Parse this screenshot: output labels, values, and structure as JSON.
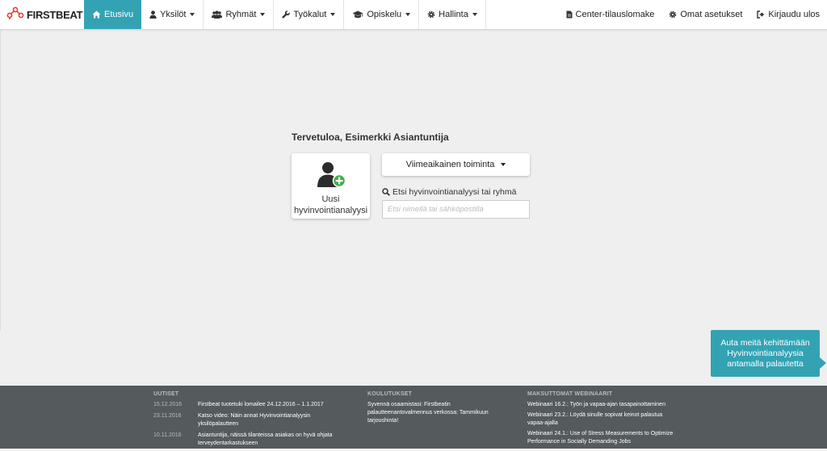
{
  "brand": {
    "name": "FIRSTBEAT"
  },
  "nav": {
    "items": [
      {
        "label": "Etusivu",
        "icon": "home-icon",
        "active": true,
        "dropdown": false
      },
      {
        "label": "Yksilöt",
        "icon": "user-icon",
        "active": false,
        "dropdown": true
      },
      {
        "label": "Ryhmät",
        "icon": "users-icon",
        "active": false,
        "dropdown": true
      },
      {
        "label": "Työkalut",
        "icon": "wrench-icon",
        "active": false,
        "dropdown": true
      },
      {
        "label": "Opiskelu",
        "icon": "graduation-cap-icon",
        "active": false,
        "dropdown": true
      },
      {
        "label": "Hallinta",
        "icon": "gear-icon",
        "active": false,
        "dropdown": true
      }
    ],
    "right": [
      {
        "label": "Center-tilauslomake",
        "icon": "document-icon"
      },
      {
        "label": "Omat asetukset",
        "icon": "gear-icon"
      },
      {
        "label": "Kirjaudu ulos",
        "icon": "sign-out-icon"
      }
    ]
  },
  "main": {
    "welcome": "Tervetuloa, Esimerkki Asiantuntija",
    "new_analysis": {
      "line1": "Uusi",
      "line2": "hyvinvointianalyysi",
      "icon": "add-user-icon"
    },
    "recent_activity": "Viimeaikainen toiminta",
    "search": {
      "label": "Etsi hyvinvointianalyysi tai ryhmä",
      "placeholder": "Etsi nimellä tai sähköpostilla"
    }
  },
  "feedback": {
    "text": "Auta meitä kehittämään Hyvinvointianalyysia antamalla palautetta"
  },
  "footer": {
    "news": {
      "title": "UUTISET",
      "items": [
        {
          "date": "15.12.2016",
          "text": "Firstbeat tuotetuki lomailee 24.12.2016 – 1.1.2017"
        },
        {
          "date": "23.11.2016",
          "text": "Katso video: Näin annat Hyvinvointianalyysin yksilöpalautteen"
        },
        {
          "date": "10.11.2016",
          "text": "Asiantuntija, näissä tilanteissa asiakas on hyvä ohjata terveydentarkastukseen"
        }
      ]
    },
    "trainings": {
      "title": "KOULUTUKSET",
      "items": [
        "Syvennä osaamistasi: Firstbeatin palautteenantovalmennus verkossa: Tammikuun tarjoushinta!"
      ]
    },
    "webinars": {
      "title": "MAKSUTTOMAT WEBINAARIT",
      "items": [
        "Webinaari 16.2.: Työn ja vapaa-ajan tasapainottaminen",
        "Webinaari 23.2.: Löydä sinulle sopivat keinot palautua vapaa-ajalla",
        "Webinaari 24.1.: Use of Stress Measurements to Optimize Performance in Socially Demanding Jobs"
      ]
    }
  },
  "colors": {
    "accent": "#33a3b4",
    "footer_bg": "#555a5c",
    "page_bg": "#efefef",
    "logo": "#e0412b"
  }
}
